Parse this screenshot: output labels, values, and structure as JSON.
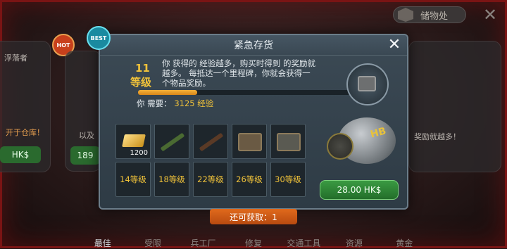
{
  "storage": {
    "label": "储物处",
    "icon": "box-icon"
  },
  "left_card": {
    "title": "浮落者",
    "sub1": "以及",
    "notice": "开于仓库！",
    "price": "HK$",
    "hot_badge": "HOT"
  },
  "mid_card": {
    "best_badge": "BEST",
    "price": "189"
  },
  "right_card": {
    "text": "奖励就越多！"
  },
  "dialog": {
    "title": "紧急存货",
    "level_number": "11",
    "level_label": "等级",
    "description": "你 获得的 经验越多，购买时得到 的奖励就越多。 每抵达一个里程碑，你就会获得一个物品奖励。",
    "progress": 0.27,
    "need_label": "你 需要：",
    "need_value": "3125 经验",
    "reward_qty": "1200",
    "locked_levels": [
      "14等级",
      "18等级",
      "22等级",
      "26等级",
      "30等级"
    ],
    "price_button": "28.00 HK$",
    "piggy_label": "HB"
  },
  "available": "还可获取：1",
  "nav": [
    "最佳",
    "受限",
    "兵工厂",
    "修复",
    "交通工具",
    "资源",
    "黄金"
  ],
  "colors": {
    "accent_gold": "#f0c23a",
    "progress": "#f4b23a",
    "buy_green": "#2e8a36",
    "available_orange": "#e06a1c"
  }
}
